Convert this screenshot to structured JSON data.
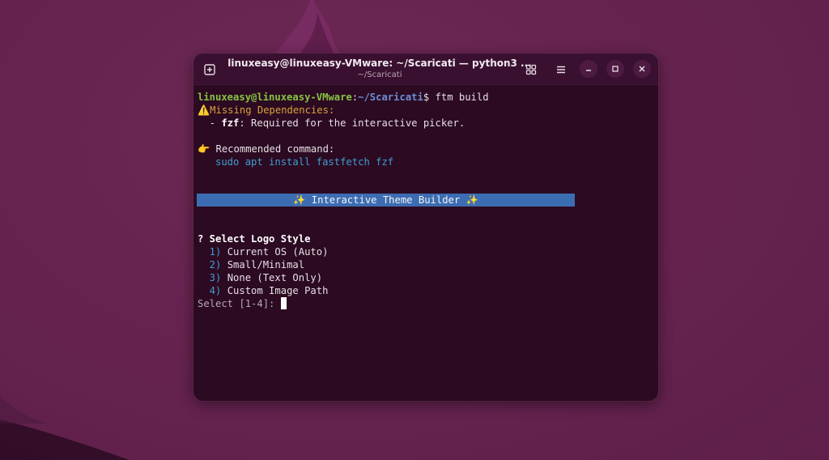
{
  "window": {
    "title": "linuxeasy@linuxeasy-VMware: ~/Scaricati — python3 ...",
    "subtitle": "~/Scaricati"
  },
  "icons": {
    "new_tab": "new-tab-icon",
    "grid": "grid-view-icon",
    "menu": "hamburger-menu-icon",
    "minimize": "minimize-icon",
    "maximize": "maximize-icon",
    "close": "close-icon"
  },
  "terminal": {
    "prompt_user": "linuxeasy@linuxeasy-VMware",
    "prompt_sep": ":",
    "prompt_path": "~/Scaricati",
    "prompt_symbol": "$ ",
    "command": "ftm build",
    "warning": "⚠️Missing Dependencies:",
    "dep_bullet": "  - ",
    "dep_name": "fzf",
    "dep_desc": ": Required for the interactive picker.",
    "recommend_label": "👉 Recommended command:",
    "recommend_cmd": "   sudo apt install fastfetch fzf",
    "banner": "✨ Interactive Theme Builder ✨",
    "question": "? Select Logo Style",
    "options": [
      {
        "num": "  1)",
        "label": " Current OS (Auto)"
      },
      {
        "num": "  2)",
        "label": " Small/Minimal"
      },
      {
        "num": "  3)",
        "label": " None (Text Only)"
      },
      {
        "num": "  4)",
        "label": " Custom Image Path"
      }
    ],
    "input_prompt": "Select [1-4]: "
  },
  "colors": {
    "desktop_bg": "#672350",
    "terminal_bg": "#2c0a22",
    "prompt_user": "#86c341",
    "prompt_path": "#6b8fd6",
    "warning": "#d9a238",
    "command_hint": "#3f9fd1",
    "banner_bg": "#3c6db3"
  }
}
